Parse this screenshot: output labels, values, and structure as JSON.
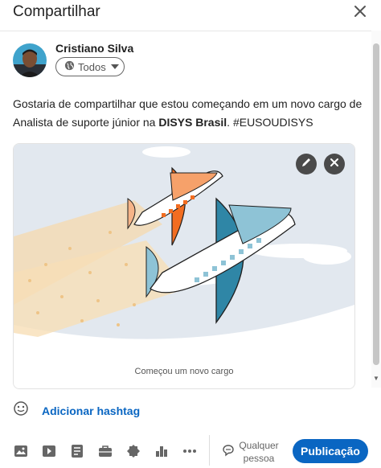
{
  "modal": {
    "title": "Compartilhar",
    "close_icon": "close-icon"
  },
  "author": {
    "name": "Cristiano Silva",
    "visibility": "Todos",
    "visibility_icon": "globe-icon"
  },
  "post": {
    "text_before": "Gostaria de compartilhar que estou começando em um novo cargo de Analista de suporte júnior na ",
    "company": "DISYS Brasil",
    "text_after": ". #EUSOUDISYS"
  },
  "card": {
    "caption": "Começou um novo cargo",
    "edit_icon": "pencil-icon",
    "remove_icon": "close-icon"
  },
  "hashtag": {
    "label": "Adicionar hashtag",
    "icon": "smiley-icon"
  },
  "toolbar": {
    "icons": [
      "image-icon",
      "video-icon",
      "document-icon",
      "briefcase-icon",
      "badge-icon",
      "bar-chart-icon",
      "more-icon"
    ],
    "audience_line1": "Qualquer",
    "audience_line2": "pessoa",
    "audience_icon": "speech-bubble-icon",
    "publish_label": "Publicação"
  },
  "colors": {
    "accent": "#0a66c2",
    "plane_orange": "#f26d21",
    "plane_blue": "#2f86a6",
    "plane_light_blue": "#8ec3d6",
    "sky": "#e2e8ef"
  }
}
